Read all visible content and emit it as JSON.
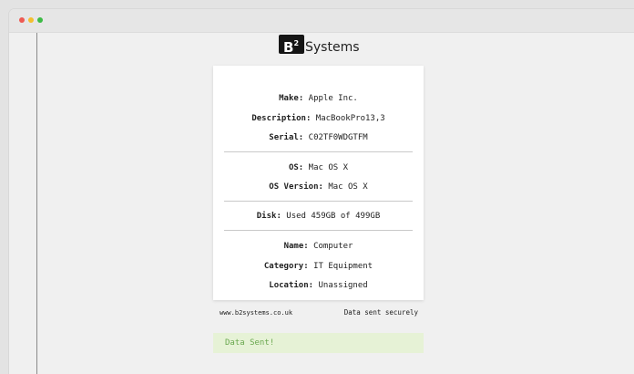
{
  "brand": {
    "badge": "B",
    "badge_sup": "2",
    "name": "Systems"
  },
  "device": {
    "make_label": "Make:",
    "make_value": "Apple Inc.",
    "description_label": "Description:",
    "description_value": "MacBookPro13,3",
    "serial_label": "Serial:",
    "serial_value": "C02TF0WDGTFM",
    "os_label": "OS:",
    "os_value": "Mac OS X",
    "os_version_label": "OS Version:",
    "os_version_value": "Mac OS X",
    "disk_label": "Disk:",
    "disk_value": "Used 459GB of 499GB",
    "name_label": "Name:",
    "name_value": "Computer",
    "category_label": "Category:",
    "category_value": "IT Equipment",
    "location_label": "Location:",
    "location_value": "Unassigned"
  },
  "footer": {
    "website": "www.b2systems.co.uk",
    "secure_note": "Data sent securely"
  },
  "status": {
    "message": "Data Sent!"
  },
  "colors": {
    "status_bg": "#e6f2d6",
    "status_text": "#6aa84f"
  }
}
